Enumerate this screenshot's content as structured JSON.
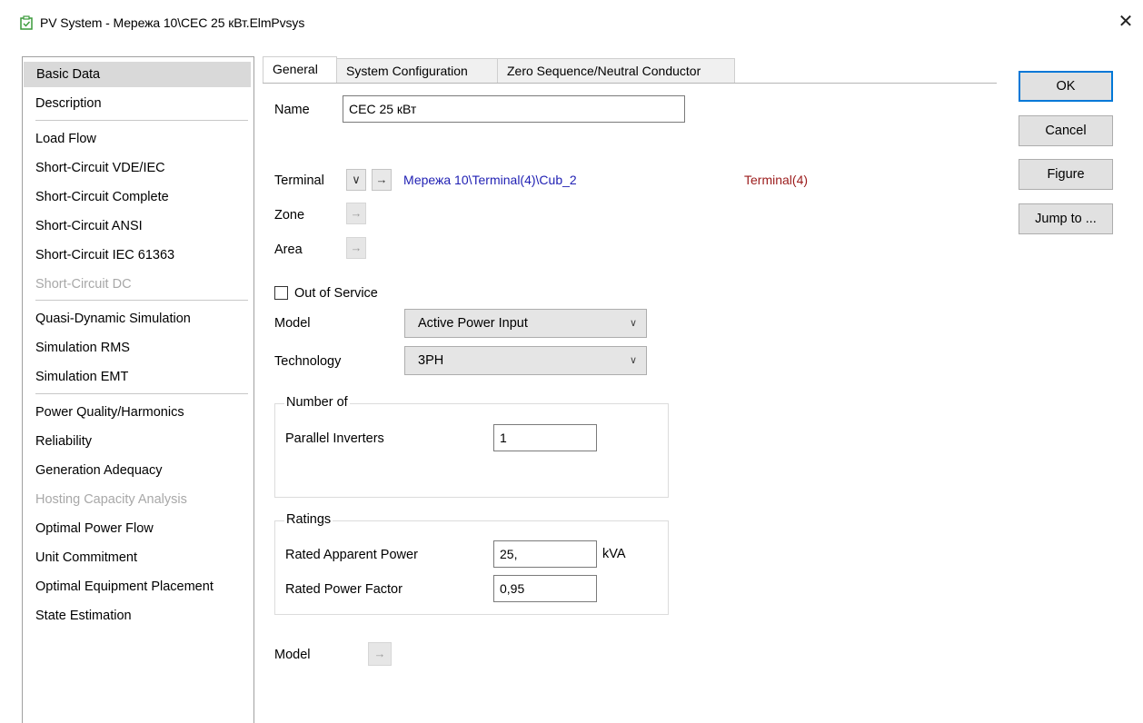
{
  "window": {
    "title": "PV System - Мережа 10\\СЕС 25 кВт.ElmPvsys",
    "close_glyph": "✕"
  },
  "sidebar": {
    "items": [
      {
        "label": "Basic Data",
        "state": "selected"
      },
      {
        "label": "Description",
        "state": "normal"
      },
      {
        "label": "Load Flow",
        "state": "normal"
      },
      {
        "label": "Short-Circuit VDE/IEC",
        "state": "normal"
      },
      {
        "label": "Short-Circuit Complete",
        "state": "normal"
      },
      {
        "label": "Short-Circuit ANSI",
        "state": "normal"
      },
      {
        "label": "Short-Circuit IEC 61363",
        "state": "normal"
      },
      {
        "label": "Short-Circuit DC",
        "state": "disabled"
      },
      {
        "label": "Quasi-Dynamic Simulation",
        "state": "normal"
      },
      {
        "label": "Simulation RMS",
        "state": "normal"
      },
      {
        "label": "Simulation EMT",
        "state": "normal"
      },
      {
        "label": "Power Quality/Harmonics",
        "state": "normal"
      },
      {
        "label": "Reliability",
        "state": "normal"
      },
      {
        "label": "Generation Adequacy",
        "state": "normal"
      },
      {
        "label": "Hosting Capacity Analysis",
        "state": "disabled"
      },
      {
        "label": "Optimal Power Flow",
        "state": "normal"
      },
      {
        "label": "Unit Commitment",
        "state": "normal"
      },
      {
        "label": "Optimal Equipment Placement",
        "state": "normal"
      },
      {
        "label": "State Estimation",
        "state": "normal"
      }
    ]
  },
  "tabs": [
    {
      "label": "General",
      "active": true
    },
    {
      "label": "System Configuration",
      "active": false
    },
    {
      "label": "Zero Sequence/Neutral Conductor",
      "active": false
    }
  ],
  "buttons": {
    "ok": "OK",
    "cancel": "Cancel",
    "figure": "Figure",
    "jump_to": "Jump to ..."
  },
  "form": {
    "name_label": "Name",
    "name_value": "СЕС 25 кВт",
    "terminal_label": "Terminal",
    "terminal_dropdown_glyph": "∨",
    "arrow_glyph": "→",
    "terminal_path": "Мережа 10\\Terminal(4)\\Cub_2",
    "terminal_name": "Terminal(4)",
    "zone_label": "Zone",
    "area_label": "Area",
    "out_of_service_label": "Out of Service",
    "out_of_service_checked": false,
    "model_label": "Model",
    "model_value": "Active Power Input",
    "technology_label": "Technology",
    "technology_value": "3PH",
    "combo_arrow_glyph": "∨",
    "number_of_group": "Number of",
    "parallel_inverters_label": "Parallel Inverters",
    "parallel_inverters_value": "1",
    "ratings_group": "Ratings",
    "rated_apparent_power_label": "Rated Apparent Power",
    "rated_apparent_power_value": "25,",
    "rated_apparent_power_unit": "kVA",
    "rated_power_factor_label": "Rated Power Factor",
    "rated_power_factor_value": "0,95",
    "model2_label": "Model"
  },
  "colors": {
    "link_blue": "#1f1fb3",
    "terminal_red": "#9b1b1b",
    "selected_bg": "#d9d9d9",
    "default_button_border": "#0078d7"
  }
}
